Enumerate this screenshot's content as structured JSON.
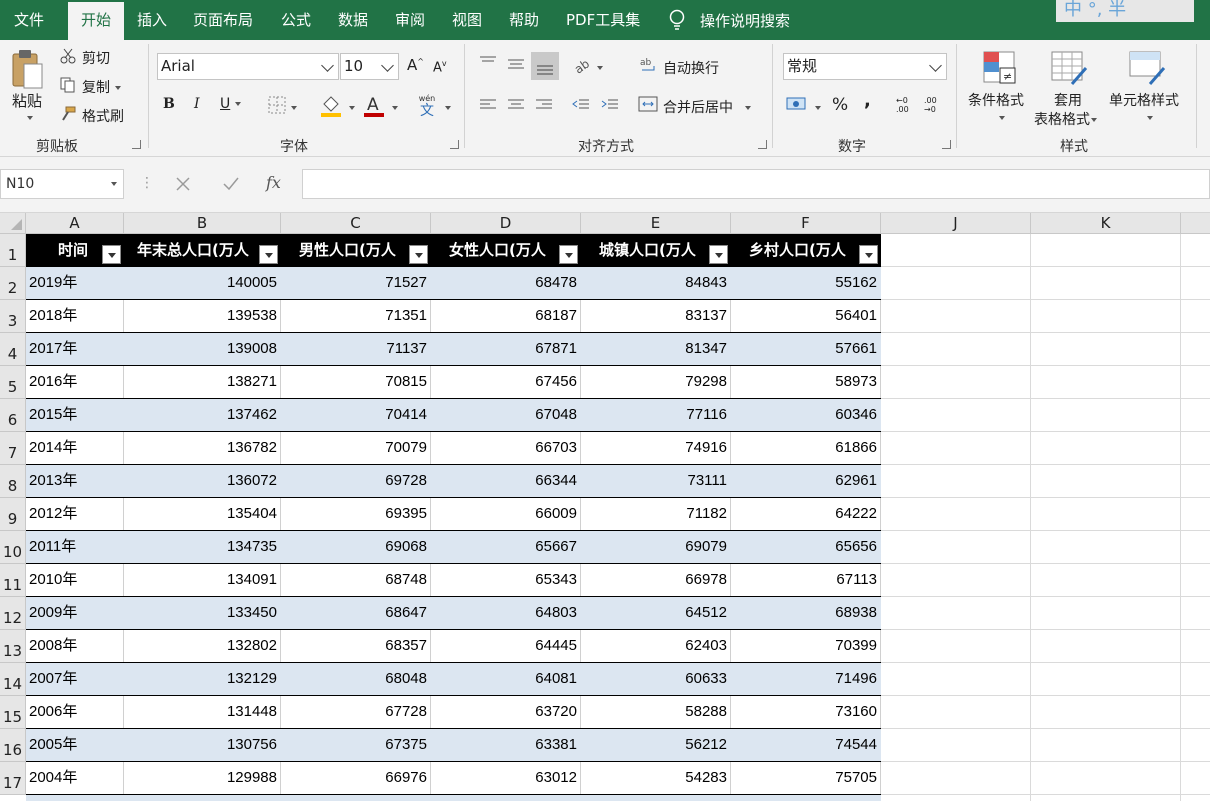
{
  "tabs": [
    "文件",
    "开始",
    "插入",
    "页面布局",
    "公式",
    "数据",
    "审阅",
    "视图",
    "帮助",
    "PDF工具集"
  ],
  "active_tab": "开始",
  "tell_me": "操作说明搜索",
  "ime": "中 °, 半",
  "colors": {
    "accent": "#217346",
    "band": "#dce6f1",
    "header_fill": "#000000"
  },
  "clipboard": {
    "paste": "粘贴",
    "cut": "剪切",
    "copy": "复制",
    "format_painter": "格式刷",
    "group": "剪贴板"
  },
  "font": {
    "name": "Arial",
    "size": "10",
    "bold": "B",
    "italic": "I",
    "underline": "U",
    "group": "字体",
    "wen": "wén",
    "wen_char": "文"
  },
  "alignment": {
    "wrap": "自动换行",
    "merge": "合并后居中",
    "group": "对齐方式"
  },
  "number": {
    "format": "常规",
    "percent": "%",
    "comma": ",",
    "inc": "←0 .00",
    "dec": ".00 →0",
    "group": "数字"
  },
  "styles": {
    "conditional": "条件格式",
    "table_format_1": "套用",
    "table_format_2": "表格格式",
    "cell_styles": "单元格样式",
    "group": "样式"
  },
  "namebox": "N10",
  "fx": "fx",
  "columns": [
    "A",
    "B",
    "C",
    "D",
    "E",
    "F",
    "J",
    "K"
  ],
  "rows": [
    "1",
    "2",
    "3",
    "4",
    "5",
    "6",
    "7",
    "8",
    "9",
    "10",
    "11",
    "12",
    "13",
    "14",
    "15",
    "16",
    "17"
  ],
  "table": {
    "headers": [
      "时间",
      "年末总人口(万人",
      "男性人口(万人",
      "女性人口(万人",
      "城镇人口(万人",
      "乡村人口(万人"
    ],
    "rows": [
      [
        "2019年",
        "140005",
        "71527",
        "68478",
        "84843",
        "55162"
      ],
      [
        "2018年",
        "139538",
        "71351",
        "68187",
        "83137",
        "56401"
      ],
      [
        "2017年",
        "139008",
        "71137",
        "67871",
        "81347",
        "57661"
      ],
      [
        "2016年",
        "138271",
        "70815",
        "67456",
        "79298",
        "58973"
      ],
      [
        "2015年",
        "137462",
        "70414",
        "67048",
        "77116",
        "60346"
      ],
      [
        "2014年",
        "136782",
        "70079",
        "66703",
        "74916",
        "61866"
      ],
      [
        "2013年",
        "136072",
        "69728",
        "66344",
        "73111",
        "62961"
      ],
      [
        "2012年",
        "135404",
        "69395",
        "66009",
        "71182",
        "64222"
      ],
      [
        "2011年",
        "134735",
        "69068",
        "65667",
        "69079",
        "65656"
      ],
      [
        "2010年",
        "134091",
        "68748",
        "65343",
        "66978",
        "67113"
      ],
      [
        "2009年",
        "133450",
        "68647",
        "64803",
        "64512",
        "68938"
      ],
      [
        "2008年",
        "132802",
        "68357",
        "64445",
        "62403",
        "70399"
      ],
      [
        "2007年",
        "132129",
        "68048",
        "64081",
        "60633",
        "71496"
      ],
      [
        "2006年",
        "131448",
        "67728",
        "63720",
        "58288",
        "73160"
      ],
      [
        "2005年",
        "130756",
        "67375",
        "63381",
        "56212",
        "74544"
      ],
      [
        "2004年",
        "129988",
        "66976",
        "63012",
        "54283",
        "75705"
      ]
    ]
  }
}
